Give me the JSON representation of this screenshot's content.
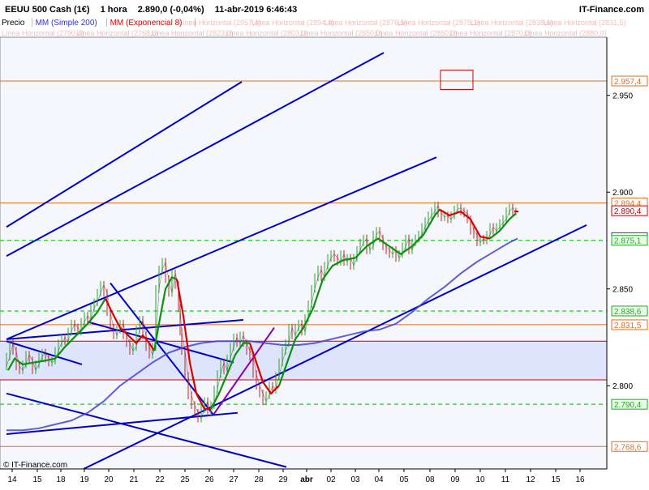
{
  "header": {
    "instrument": "EEUU 500 Cash (1€)",
    "timeframe": "1 hora",
    "last": "2.890,0 (-0,04%)",
    "datetime": "11-abr-2019 6:46:43",
    "brand": "IT-Finance.com"
  },
  "legend": {
    "items": [
      {
        "label": "Precio",
        "color": "#000000"
      },
      {
        "label": "MM (Simple 200)",
        "color": "#3333cc"
      },
      {
        "label": "MM (Exponencial 8)",
        "color": "#dd0000"
      }
    ],
    "faded_labels": [
      "Línea Horizontal (2957,4)",
      "Línea Horizontal (2894,4)",
      "Línea Horizontal (2876,5)",
      "Línea Horizontal (2875,1)",
      "Línea Horizontal (2838,6)",
      "Línea Horizontal (2831,5)",
      "Línea Horizontal (2790,4)",
      "Línea Horizontal (2768,6)",
      "Línea Horizontal (2823,0)",
      "Línea Horizontal (2803,0)",
      "Línea Horizontal (2850,0)",
      "Línea Horizontal (2860,0)",
      "Línea Horizontal (2870,0)",
      "Línea Horizontal (2880,0)"
    ]
  },
  "footer": {
    "copyright": "© IT-Finance.com"
  },
  "colors": {
    "accent_orange": "#e07020",
    "dashed_green": "#33dd33",
    "support_red": "#cc0000",
    "trend_blue": "#0000cc",
    "channel_purple": "#8800aa",
    "sma_blue": "#4444cc",
    "ema_green": "#109010",
    "ema_red": "#dd0000",
    "zone_fill": "#dde4fb"
  },
  "chart_data": {
    "type": "line",
    "title": "EEUU 500 Cash (1€) 1 hora",
    "xlabel": "",
    "ylabel": "",
    "ylim": [
      2757,
      2980
    ],
    "grid": false,
    "legend_position": "top-left",
    "x_ticks": [
      "14",
      "15",
      "18",
      "19",
      "20",
      "21",
      "22",
      "25",
      "26",
      "27",
      "28",
      "29",
      "abr",
      "02",
      "03",
      "04",
      "05",
      "08",
      "09",
      "10",
      "11",
      "12",
      "15",
      "16"
    ],
    "y_ticks": [
      {
        "value": 2950,
        "label": "2.950"
      },
      {
        "value": 2900,
        "label": "2.900"
      },
      {
        "value": 2850,
        "label": "2.850"
      },
      {
        "value": 2800,
        "label": "2.800"
      }
    ],
    "horizontal_lines": [
      {
        "value": 2957.4,
        "label": "2.957,4",
        "style": "solid",
        "color": "#e07020",
        "label_color": "#e07020",
        "label_bg": "#ffffff"
      },
      {
        "value": 2894.4,
        "label": "2.894,4",
        "style": "solid",
        "color": "#e07020",
        "label_color": "#e07020",
        "label_bg": "#ffffff"
      },
      {
        "value": 2890.4,
        "label": "2.890,4",
        "style": "none",
        "color": "#cc0000",
        "label_color": "#cc0000",
        "label_bg": "#ffffff"
      },
      {
        "value": 2876.5,
        "label": "2.876,5",
        "style": "none",
        "color": "#3333cc",
        "label_color": "#3333cc",
        "label_bg": "#ffffff"
      },
      {
        "value": 2875.1,
        "label": "2.875,1",
        "style": "dashed",
        "color": "#33dd33",
        "label_color": "#22aa22",
        "label_bg": "#e8ffe8"
      },
      {
        "value": 2838.6,
        "label": "2.838,6",
        "style": "dashed",
        "color": "#33dd33",
        "label_color": "#22aa22",
        "label_bg": "#e8ffe8"
      },
      {
        "value": 2831.5,
        "label": "2.831,5",
        "style": "solid",
        "color": "#e07020",
        "label_color": "#e07020",
        "label_bg": "#ffffff"
      },
      {
        "value": 2790.4,
        "label": "2.790,4",
        "style": "dashed",
        "color": "#33dd33",
        "label_color": "#22aa22",
        "label_bg": "#e8ffe8"
      },
      {
        "value": 2768.6,
        "label": "2.768,6",
        "style": "solid",
        "color": "#e07020",
        "label_color": "#e07020",
        "label_bg": "#ffffff"
      }
    ],
    "support_zone": {
      "from": 2803.0,
      "to": 2823.0,
      "color": "#cc0000"
    },
    "price_series": [
      [
        0,
        2810
      ],
      [
        4,
        2815
      ],
      [
        8,
        2822
      ],
      [
        12,
        2818
      ],
      [
        16,
        2810
      ],
      [
        20,
        2808
      ],
      [
        24,
        2811
      ],
      [
        28,
        2816
      ],
      [
        32,
        2813
      ],
      [
        36,
        2808
      ],
      [
        40,
        2811
      ],
      [
        44,
        2815
      ],
      [
        48,
        2817
      ],
      [
        52,
        2814
      ],
      [
        56,
        2812
      ],
      [
        60,
        2813
      ],
      [
        64,
        2818
      ],
      [
        68,
        2822
      ],
      [
        72,
        2825
      ],
      [
        76,
        2823
      ],
      [
        80,
        2828
      ],
      [
        84,
        2832
      ],
      [
        88,
        2830
      ],
      [
        92,
        2828
      ],
      [
        96,
        2833
      ],
      [
        100,
        2836
      ],
      [
        104,
        2834
      ],
      [
        108,
        2840
      ],
      [
        112,
        2843
      ],
      [
        116,
        2848
      ],
      [
        120,
        2852
      ],
      [
        124,
        2848
      ],
      [
        128,
        2838
      ],
      [
        132,
        2830
      ],
      [
        136,
        2826
      ],
      [
        140,
        2829
      ],
      [
        144,
        2832
      ],
      [
        148,
        2826
      ],
      [
        152,
        2822
      ],
      [
        156,
        2818
      ],
      [
        160,
        2820
      ],
      [
        164,
        2829
      ],
      [
        168,
        2834
      ],
      [
        172,
        2826
      ],
      [
        176,
        2820
      ],
      [
        180,
        2816
      ],
      [
        184,
        2820
      ],
      [
        188,
        2850
      ],
      [
        192,
        2860
      ],
      [
        196,
        2864
      ],
      [
        200,
        2855
      ],
      [
        204,
        2848
      ],
      [
        208,
        2858
      ],
      [
        212,
        2852
      ],
      [
        214,
        2840
      ],
      [
        216,
        2828
      ],
      [
        220,
        2818
      ],
      [
        224,
        2805
      ],
      [
        228,
        2795
      ],
      [
        232,
        2790
      ],
      [
        236,
        2786
      ],
      [
        240,
        2783
      ],
      [
        244,
        2788
      ],
      [
        248,
        2792
      ],
      [
        252,
        2786
      ],
      [
        256,
        2790
      ],
      [
        260,
        2798
      ],
      [
        264,
        2806
      ],
      [
        268,
        2812
      ],
      [
        272,
        2808
      ],
      [
        276,
        2814
      ],
      [
        280,
        2820
      ],
      [
        284,
        2825
      ],
      [
        288,
        2822
      ],
      [
        292,
        2826
      ],
      [
        296,
        2822
      ],
      [
        300,
        2818
      ],
      [
        304,
        2815
      ],
      [
        308,
        2806
      ],
      [
        312,
        2800
      ],
      [
        316,
        2796
      ],
      [
        320,
        2792
      ],
      [
        324,
        2795
      ],
      [
        328,
        2800
      ],
      [
        332,
        2798
      ],
      [
        336,
        2805
      ],
      [
        340,
        2812
      ],
      [
        344,
        2818
      ],
      [
        348,
        2822
      ],
      [
        352,
        2830
      ],
      [
        356,
        2826
      ],
      [
        360,
        2830
      ],
      [
        364,
        2832
      ],
      [
        368,
        2828
      ],
      [
        372,
        2835
      ],
      [
        376,
        2842
      ],
      [
        380,
        2850
      ],
      [
        384,
        2856
      ],
      [
        388,
        2860
      ],
      [
        392,
        2856
      ],
      [
        396,
        2862
      ],
      [
        400,
        2866
      ],
      [
        404,
        2868
      ],
      [
        408,
        2866
      ],
      [
        412,
        2864
      ],
      [
        416,
        2868
      ],
      [
        420,
        2864
      ],
      [
        424,
        2866
      ],
      [
        428,
        2862
      ],
      [
        432,
        2866
      ],
      [
        436,
        2870
      ],
      [
        440,
        2874
      ],
      [
        444,
        2876
      ],
      [
        448,
        2870
      ],
      [
        452,
        2872
      ],
      [
        456,
        2878
      ],
      [
        460,
        2880
      ],
      [
        464,
        2876
      ],
      [
        468,
        2872
      ],
      [
        472,
        2870
      ],
      [
        476,
        2868
      ],
      [
        480,
        2870
      ],
      [
        484,
        2866
      ],
      [
        488,
        2868
      ],
      [
        492,
        2872
      ],
      [
        496,
        2876
      ],
      [
        500,
        2870
      ],
      [
        504,
        2874
      ],
      [
        508,
        2876
      ],
      [
        512,
        2878
      ],
      [
        516,
        2882
      ],
      [
        520,
        2885
      ],
      [
        524,
        2888
      ],
      [
        528,
        2890
      ],
      [
        532,
        2893
      ],
      [
        536,
        2889
      ],
      [
        540,
        2887
      ],
      [
        544,
        2888
      ],
      [
        548,
        2886
      ],
      [
        552,
        2888
      ],
      [
        556,
        2891
      ],
      [
        560,
        2892
      ],
      [
        564,
        2890
      ],
      [
        568,
        2889
      ],
      [
        572,
        2886
      ],
      [
        576,
        2880
      ],
      [
        580,
        2878
      ],
      [
        584,
        2874
      ],
      [
        588,
        2876
      ],
      [
        592,
        2875
      ],
      [
        596,
        2878
      ],
      [
        600,
        2882
      ],
      [
        604,
        2880
      ],
      [
        608,
        2882
      ],
      [
        612,
        2884
      ],
      [
        616,
        2886
      ],
      [
        620,
        2890
      ],
      [
        624,
        2892
      ],
      [
        628,
        2890
      ],
      [
        630,
        2890
      ]
    ],
    "ema8_segments": [
      {
        "color": "#109010",
        "points": [
          [
            2,
            2808
          ],
          [
            10,
            2814
          ],
          [
            20,
            2811
          ],
          [
            34,
            2812
          ],
          [
            48,
            2813
          ],
          [
            60,
            2814
          ],
          [
            72,
            2820
          ],
          [
            86,
            2826
          ],
          [
            100,
            2832
          ],
          [
            112,
            2838
          ],
          [
            122,
            2845
          ]
        ]
      },
      {
        "color": "#dd0000",
        "points": [
          [
            122,
            2845
          ],
          [
            130,
            2838
          ],
          [
            140,
            2830
          ],
          [
            150,
            2826
          ],
          [
            160,
            2822
          ],
          [
            168,
            2826
          ],
          [
            176,
            2822
          ],
          [
            182,
            2818
          ]
        ]
      },
      {
        "color": "#109010",
        "points": [
          [
            182,
            2818
          ],
          [
            188,
            2832
          ],
          [
            196,
            2850
          ],
          [
            204,
            2856
          ],
          [
            210,
            2855
          ]
        ]
      },
      {
        "color": "#dd0000",
        "points": [
          [
            210,
            2855
          ],
          [
            218,
            2836
          ],
          [
            226,
            2812
          ],
          [
            234,
            2796
          ],
          [
            244,
            2788
          ],
          [
            252,
            2788
          ]
        ]
      },
      {
        "color": "#109010",
        "points": [
          [
            252,
            2788
          ],
          [
            262,
            2796
          ],
          [
            272,
            2806
          ],
          [
            282,
            2816
          ],
          [
            292,
            2822
          ],
          [
            300,
            2822
          ]
        ]
      },
      {
        "color": "#dd0000",
        "points": [
          [
            300,
            2822
          ],
          [
            308,
            2812
          ],
          [
            316,
            2802
          ],
          [
            326,
            2796
          ],
          [
            336,
            2800
          ]
        ]
      },
      {
        "color": "#109010",
        "points": [
          [
            336,
            2800
          ],
          [
            346,
            2812
          ],
          [
            356,
            2824
          ],
          [
            366,
            2830
          ],
          [
            378,
            2840
          ],
          [
            390,
            2855
          ],
          [
            402,
            2862
          ],
          [
            416,
            2865
          ],
          [
            430,
            2866
          ],
          [
            444,
            2872
          ],
          [
            458,
            2876
          ],
          [
            472,
            2872
          ],
          [
            486,
            2868
          ],
          [
            500,
            2872
          ],
          [
            514,
            2878
          ],
          [
            528,
            2888
          ],
          [
            534,
            2891
          ]
        ]
      },
      {
        "color": "#dd0000",
        "points": [
          [
            534,
            2891
          ],
          [
            546,
            2888
          ],
          [
            560,
            2890
          ],
          [
            572,
            2886
          ],
          [
            584,
            2877
          ],
          [
            596,
            2876
          ]
        ]
      },
      {
        "color": "#109010",
        "points": [
          [
            596,
            2876
          ],
          [
            608,
            2880
          ],
          [
            620,
            2886
          ],
          [
            628,
            2889
          ]
        ]
      },
      {
        "color": "#dd0000",
        "points": [
          [
            626,
            2890
          ],
          [
            631,
            2890
          ]
        ]
      }
    ],
    "sma200_series": [
      [
        0,
        2777
      ],
      [
        20,
        2777
      ],
      [
        40,
        2778
      ],
      [
        60,
        2780
      ],
      [
        80,
        2782
      ],
      [
        100,
        2786
      ],
      [
        120,
        2792
      ],
      [
        140,
        2800
      ],
      [
        160,
        2806
      ],
      [
        180,
        2812
      ],
      [
        200,
        2817
      ],
      [
        220,
        2820
      ],
      [
        240,
        2822
      ],
      [
        260,
        2823
      ],
      [
        280,
        2823
      ],
      [
        300,
        2823
      ],
      [
        320,
        2822
      ],
      [
        340,
        2821
      ],
      [
        360,
        2821
      ],
      [
        380,
        2822
      ],
      [
        400,
        2824
      ],
      [
        420,
        2826
      ],
      [
        440,
        2828
      ],
      [
        460,
        2829
      ],
      [
        480,
        2832
      ],
      [
        500,
        2838
      ],
      [
        520,
        2845
      ],
      [
        540,
        2851
      ],
      [
        560,
        2858
      ],
      [
        580,
        2864
      ],
      [
        600,
        2869
      ],
      [
        620,
        2874
      ],
      [
        630,
        2876
      ]
    ],
    "trendlines": [
      {
        "color": "#0000cc",
        "points": [
          [
            0,
            2882
          ],
          [
            290,
            2957
          ]
        ]
      },
      {
        "color": "#0000cc",
        "points": [
          [
            0,
            2867
          ],
          [
            465,
            2972
          ]
        ]
      },
      {
        "color": "#0000cc",
        "points": [
          [
            0,
            2824
          ],
          [
            530,
            2918
          ]
        ]
      },
      {
        "color": "#0000cc",
        "points": [
          [
            95,
            2757
          ],
          [
            715,
            2883
          ]
        ]
      },
      {
        "color": "#0000cc",
        "points": [
          [
            0,
            2775
          ],
          [
            285,
            2786
          ]
        ]
      },
      {
        "color": "#0000cc",
        "points": [
          [
            0,
            2824
          ],
          [
            292,
            2834
          ]
        ]
      },
      {
        "color": "#0000cc",
        "points": [
          [
            0,
            2796
          ],
          [
            345,
            2758
          ]
        ]
      },
      {
        "color": "#0000cc",
        "points": [
          [
            128,
            2853
          ],
          [
            255,
            2785
          ]
        ]
      },
      {
        "color": "#0000cc",
        "points": [
          [
            0,
            2823
          ],
          [
            93,
            2811
          ]
        ]
      },
      {
        "color": "#0000cc",
        "points": [
          [
            100,
            2833
          ],
          [
            280,
            2812
          ]
        ]
      },
      {
        "color": "#8800aa",
        "points": [
          [
            255,
            2785
          ],
          [
            330,
            2830
          ]
        ]
      }
    ],
    "annotation_box": {
      "x0": 535,
      "x1": 575,
      "y0": 2953,
      "y1": 2963,
      "color": "#cc0000"
    }
  }
}
